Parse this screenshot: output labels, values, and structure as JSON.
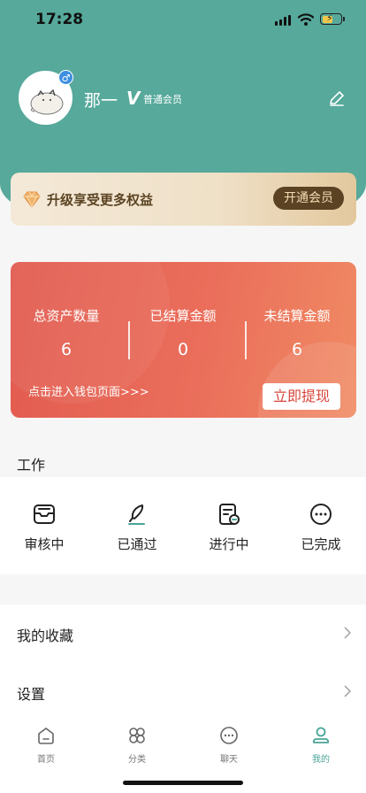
{
  "status_bar": {
    "time": "17:28"
  },
  "profile": {
    "username": "那一",
    "vip_mark": "V",
    "vip_level": "普通会员",
    "gender_icon": "male-icon"
  },
  "member_banner": {
    "text": "升级享受更多权益",
    "button": "开通会员"
  },
  "assets": {
    "columns": [
      {
        "label": "总资产数量",
        "value": "6"
      },
      {
        "label": "已结算金额",
        "value": "0"
      },
      {
        "label": "未结算金额",
        "value": "6"
      }
    ],
    "wallet_link": "点击进入钱包页面>>>",
    "withdraw_button": "立即提现"
  },
  "work": {
    "title": "工作",
    "items": [
      {
        "label": "审核中",
        "icon": "inbox-icon"
      },
      {
        "label": "已通过",
        "icon": "pen-approve-icon"
      },
      {
        "label": "进行中",
        "icon": "document-progress-icon"
      },
      {
        "label": "已完成",
        "icon": "more-circle-icon"
      }
    ]
  },
  "menu": {
    "items": [
      {
        "label": "我的收藏"
      },
      {
        "label": "设置"
      }
    ]
  },
  "tabbar": {
    "items": [
      {
        "label": "首页",
        "icon": "home-icon"
      },
      {
        "label": "分类",
        "icon": "category-icon"
      },
      {
        "label": "聊天",
        "icon": "chat-icon"
      },
      {
        "label": "我的",
        "icon": "profile-icon",
        "active": true
      }
    ]
  },
  "colors": {
    "header": "#56a99b",
    "asset_card": "#e25b4f",
    "tab_active": "#4aa598",
    "member_button": "#5a4223"
  }
}
